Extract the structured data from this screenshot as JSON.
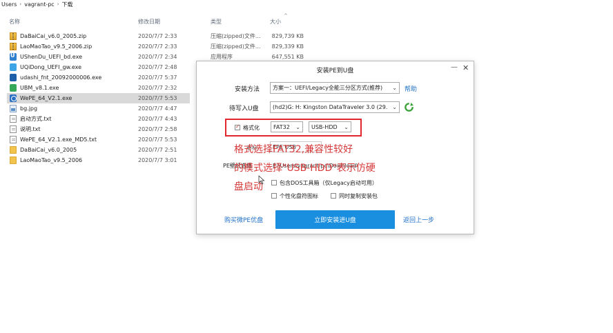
{
  "breadcrumb": [
    "Users",
    "vagrant-pc",
    "下载"
  ],
  "columns": {
    "name": "名称",
    "date": "修改日期",
    "type": "类型",
    "size": "大小"
  },
  "files": [
    {
      "name": "DaBaiCai_v6.0_2005.zip",
      "date": "2020/7/7 2:33",
      "type": "压缩(zipped)文件...",
      "size": "829,739 KB",
      "icon": "zip-icon"
    },
    {
      "name": "LaoMaoTao_v9.5_2006.zip",
      "date": "2020/7/7 2:33",
      "type": "压缩(zipped)文件...",
      "size": "829,339 KB",
      "icon": "zip-icon"
    },
    {
      "name": "UShenDu_UEFI_bd.exe",
      "date": "2020/7/7 2:34",
      "type": "应用程序",
      "size": "647,551 KB",
      "icon": "exe-icon"
    },
    {
      "name": "UQiDong_UEFI_gw.exe",
      "date": "2020/7/7 2:48",
      "type": "",
      "size": "",
      "icon": "exe-icon"
    },
    {
      "name": "udashi_fnt_20092000006.exe",
      "date": "2020/7/7 5:37",
      "type": "",
      "size": "",
      "icon": "exe-icon"
    },
    {
      "name": "UBM_v8.1.exe",
      "date": "2020/7/7 2:32",
      "type": "",
      "size": "",
      "icon": "exe-icon"
    },
    {
      "name": "WePE_64_V2.1.exe",
      "date": "2020/7/7 5:53",
      "type": "",
      "size": "",
      "icon": "exe-icon",
      "selected": true
    },
    {
      "name": "bg.jpg",
      "date": "2020/7/7 4:47",
      "type": "",
      "size": "",
      "icon": "image-icon"
    },
    {
      "name": "启动方式.txt",
      "date": "2020/7/7 4:43",
      "type": "",
      "size": "",
      "icon": "text-file-icon"
    },
    {
      "name": "说明.txt",
      "date": "2020/7/7 2:58",
      "type": "",
      "size": "",
      "icon": "text-file-icon"
    },
    {
      "name": "WePE_64_V2.1.exe_MD5.txt",
      "date": "2020/7/7 5:53",
      "type": "",
      "size": "",
      "icon": "text-file-icon"
    },
    {
      "name": "DaBaiCai_v6.0_2005",
      "date": "2020/7/7 2:51",
      "type": "",
      "size": "",
      "icon": "folder-icon"
    },
    {
      "name": "LaoMaoTao_v9.5_2006",
      "date": "2020/7/7 3:01",
      "type": "",
      "size": "",
      "icon": "folder-icon"
    }
  ],
  "dialog": {
    "title": "安装PE到U盘",
    "min_label": "—",
    "close_label": "✕",
    "install_method_label": "安装方法",
    "install_method_value": "方案一：UEFI/Legacy全能三分区方式(推荐)",
    "help_link": "帮助",
    "usb_label": "待写入U盘",
    "usb_value": "(hd2)G: H: Kingston DataTraveler 3.0 (29.",
    "format_label": "格式化",
    "format_checked": true,
    "fs_value": "FAT32",
    "mode_value": "USB-HDD",
    "volume_label": "卷标",
    "volume_value": "EPE USB",
    "pe_dir_label": "PE壁纸选择",
    "pe_dir_value": "E:\\Users\\vagrant-pc\\Download\\",
    "opt_dos": "包含DOS工具箱（仅Legacy启动可用）",
    "opt_icon": "个性化盘符图标",
    "opt_copy": "同时复制安装包",
    "buy_link": "购买微PE优盘",
    "install_button": "立即安装进U盘",
    "back_link": "返回上一步"
  },
  "annotation": {
    "line1": "格式选择FAT32,兼容性较好",
    "line2": "的模式选择\"USB-HDD\"表示仿硬",
    "line3": "盘启动"
  },
  "colors": {
    "accent": "#1a8fe0",
    "highlight_border": "#e0262b",
    "annotation_text": "#d63a3a",
    "link": "#1e6fc6"
  }
}
